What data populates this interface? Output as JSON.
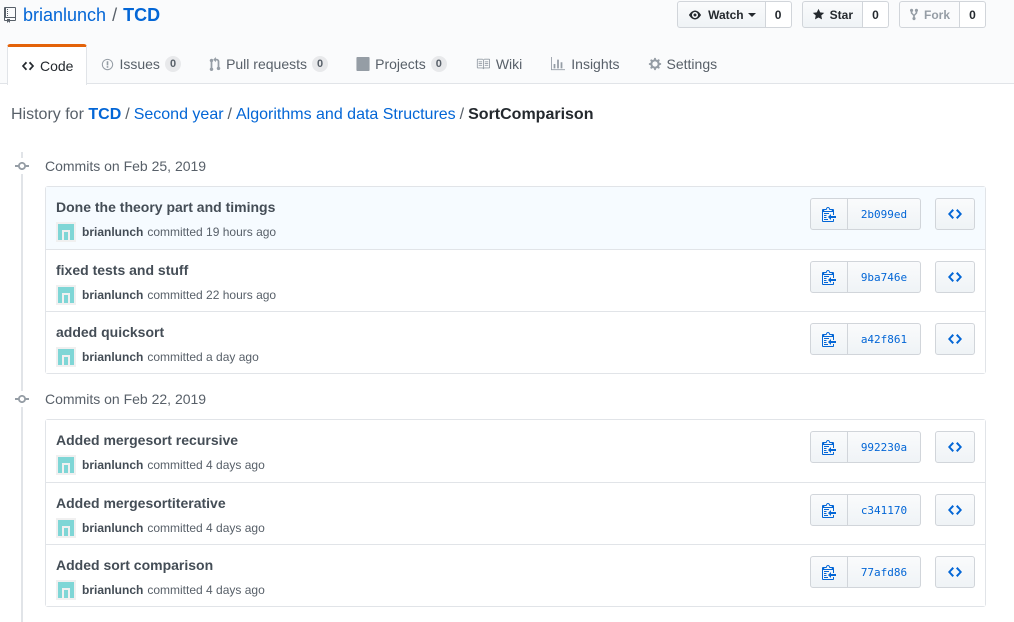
{
  "repo": {
    "owner": "brianlunch",
    "separator": "/",
    "name": "TCD"
  },
  "actions": {
    "watch": {
      "label": "Watch",
      "count": "0"
    },
    "star": {
      "label": "Star",
      "count": "0"
    },
    "fork": {
      "label": "Fork",
      "count": "0"
    }
  },
  "tabs": [
    {
      "label": "Code",
      "icon": "code-icon",
      "selected": true
    },
    {
      "label": "Issues",
      "counter": "0",
      "icon": "issue-icon"
    },
    {
      "label": "Pull requests",
      "counter": "0",
      "icon": "pull-request-icon"
    },
    {
      "label": "Projects",
      "counter": "0",
      "icon": "project-icon"
    },
    {
      "label": "Wiki",
      "icon": "book-icon"
    },
    {
      "label": "Insights",
      "icon": "graph-icon"
    },
    {
      "label": "Settings",
      "icon": "gear-icon"
    }
  ],
  "breadcrumb": {
    "prefix": "History for",
    "parts": [
      "TCD",
      "Second year",
      "Algorithms and data Structures"
    ],
    "current": "SortComparison",
    "separator": "/"
  },
  "groups": [
    {
      "title": "Commits on Feb 25, 2019",
      "commits": [
        {
          "message": "Done the theory part and timings",
          "author": "brianlunch",
          "action": "committed",
          "time": "19 hours ago",
          "sha": "2b099ed"
        },
        {
          "message": "fixed tests and stuff",
          "author": "brianlunch",
          "action": "committed",
          "time": "22 hours ago",
          "sha": "9ba746e"
        },
        {
          "message": "added quicksort",
          "author": "brianlunch",
          "action": "committed",
          "time": "a day ago",
          "sha": "a42f861"
        }
      ]
    },
    {
      "title": "Commits on Feb 22, 2019",
      "commits": [
        {
          "message": "Added mergesort recursive",
          "author": "brianlunch",
          "action": "committed",
          "time": "4 days ago",
          "sha": "992230a"
        },
        {
          "message": "Added mergesortiterative",
          "author": "brianlunch",
          "action": "committed",
          "time": "4 days ago",
          "sha": "c341170"
        },
        {
          "message": "Added sort comparison",
          "author": "brianlunch",
          "action": "committed",
          "time": "4 days ago",
          "sha": "77afd86"
        }
      ]
    }
  ],
  "colors": {
    "link": "#0366d6",
    "tab_accent": "#e36209",
    "highlight_row": "#f6fbff",
    "avatar": "#7fd6d6"
  }
}
